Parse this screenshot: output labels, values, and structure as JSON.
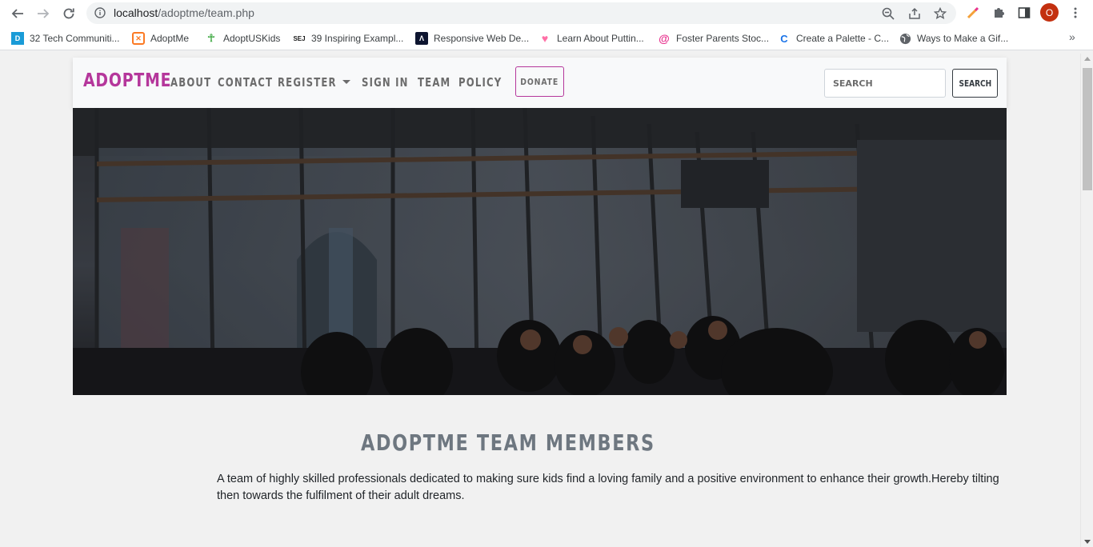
{
  "browser": {
    "url_host": "localhost",
    "url_path": "/adoptme/team.php",
    "profile_initial": "O",
    "bookmarks": [
      {
        "label": "32 Tech Communiti...",
        "icon": "letter-d-icon",
        "color": "#1a9bd7"
      },
      {
        "label": "AdoptMe",
        "icon": "xampp-icon",
        "color": "#fb7a24"
      },
      {
        "label": "AdoptUSKids",
        "icon": "figure-icon",
        "color": "#4caf50"
      },
      {
        "label": "39 Inspiring Exampl...",
        "icon": "sej-icon",
        "color": "#1b1b1b"
      },
      {
        "label": "Responsive Web De...",
        "icon": "triangle-logo-icon",
        "color": "#0e1530"
      },
      {
        "label": "Learn About Puttin...",
        "icon": "heart-icon",
        "color": "#ff6fa6"
      },
      {
        "label": "Foster Parents Stoc...",
        "icon": "swirl-icon",
        "color": "#e8338f"
      },
      {
        "label": "Create a Palette - C...",
        "icon": "c-logo-icon",
        "color": "#1a73e8"
      },
      {
        "label": "Ways to Make a Gif...",
        "icon": "globe-icon",
        "color": "#5f6368"
      }
    ]
  },
  "site": {
    "brand": "ADOPTME",
    "nav": {
      "about": "ABOUT",
      "contact": "CONTACT",
      "register": "REGISTER",
      "signin": "SIGN IN",
      "team": "TEAM",
      "policy": "POLICY"
    },
    "donate": "DONATE",
    "search_placeholder": "SEARCH",
    "search_button": "SEARCH"
  },
  "colors": {
    "brand": "#b5379b",
    "nav_text": "#6c6c6c",
    "title": "#6e7780"
  },
  "content": {
    "title": "ADOPTME TEAM MEMBERS",
    "intro": "A team of highly skilled professionals dedicated to making sure kids find a loving family and a positive environment to enhance their growth.Hereby tilting then towards the fulfilment of their adult dreams."
  }
}
